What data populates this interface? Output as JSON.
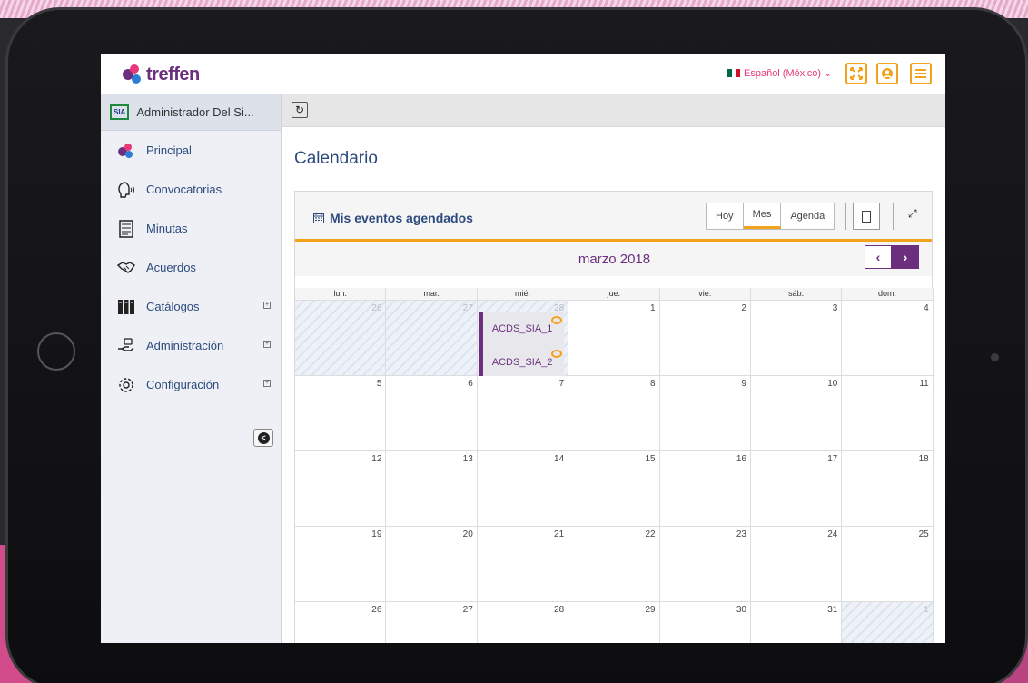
{
  "app": {
    "logo_text": "treffen"
  },
  "topbar": {
    "language": "Español (México) ⌄",
    "flag_colors": [
      "#006847",
      "#ffffff",
      "#ce1126"
    ],
    "fullscreen_icon": "fullscreen-icon",
    "user_icon": "user-icon",
    "menu_icon": "hamburger-menu-icon"
  },
  "sidebar": {
    "user_badge": "SIA",
    "user_name": "Administrador Del Si...",
    "items": [
      {
        "label": "Principal",
        "icon": "home-logo-icon",
        "expandable": false
      },
      {
        "label": "Convocatorias",
        "icon": "speech-head-icon",
        "expandable": false
      },
      {
        "label": "Minutas",
        "icon": "document-icon",
        "expandable": false
      },
      {
        "label": "Acuerdos",
        "icon": "handshake-icon",
        "expandable": false
      },
      {
        "label": "Catálogos",
        "icon": "binders-icon",
        "expandable": true
      },
      {
        "label": "Administración",
        "icon": "hand-money-icon",
        "expandable": true
      },
      {
        "label": "Configuración",
        "icon": "gears-icon",
        "expandable": true
      }
    ],
    "expand_symbol": "+"
  },
  "main": {
    "refresh_glyph": "↻",
    "title": "Calendario",
    "panel": {
      "title": "Mis eventos agendados",
      "views": [
        "Hoy",
        "Mes",
        "Agenda"
      ],
      "active_view": "Mes",
      "expand_glyph": "⤢"
    },
    "calendar": {
      "month_label": "marzo 2018",
      "prev_glyph": "‹",
      "next_glyph": "›",
      "weekdays": [
        "lun.",
        "mar.",
        "mié.",
        "jue.",
        "vie.",
        "sáb.",
        "dom."
      ],
      "weeks": [
        [
          {
            "d": "26",
            "o": true
          },
          {
            "d": "27",
            "o": true
          },
          {
            "d": "28",
            "o": true
          },
          {
            "d": "1"
          },
          {
            "d": "2"
          },
          {
            "d": "3"
          },
          {
            "d": "4"
          }
        ],
        [
          {
            "d": "5"
          },
          {
            "d": "6"
          },
          {
            "d": "7"
          },
          {
            "d": "8"
          },
          {
            "d": "9"
          },
          {
            "d": "10"
          },
          {
            "d": "11"
          }
        ],
        [
          {
            "d": "12"
          },
          {
            "d": "13"
          },
          {
            "d": "14"
          },
          {
            "d": "15"
          },
          {
            "d": "16"
          },
          {
            "d": "17"
          },
          {
            "d": "18"
          }
        ],
        [
          {
            "d": "19"
          },
          {
            "d": "20"
          },
          {
            "d": "21"
          },
          {
            "d": "22"
          },
          {
            "d": "23"
          },
          {
            "d": "24"
          },
          {
            "d": "25"
          }
        ],
        [
          {
            "d": "26"
          },
          {
            "d": "27"
          },
          {
            "d": "28"
          },
          {
            "d": "29"
          },
          {
            "d": "30"
          },
          {
            "d": "31"
          },
          {
            "d": "1",
            "o": true
          }
        ]
      ],
      "events": [
        {
          "week": 0,
          "day": 2,
          "label": "ACDS_SIA_1"
        },
        {
          "week": 0,
          "day": 2,
          "label": "ACDS_SIA_2"
        }
      ]
    }
  },
  "colors": {
    "brand": "#6b2f7e",
    "accent": "#f2a21b",
    "link": "#2c4a7d",
    "lang": "#e8387a"
  }
}
